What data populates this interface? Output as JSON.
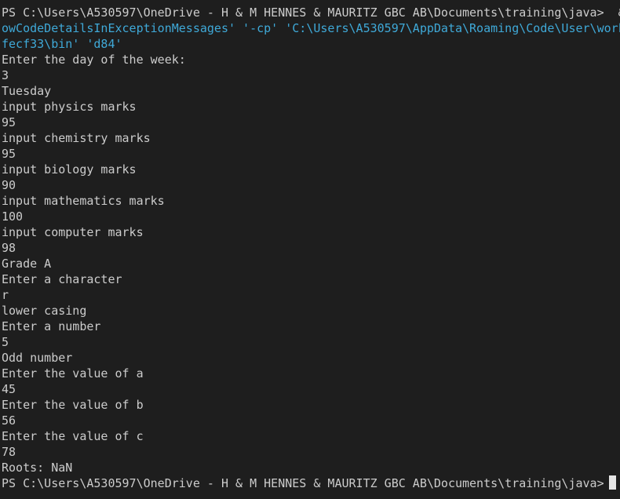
{
  "terminal": {
    "lines": [
      {
        "text": "PS C:\\Users\\A530597\\OneDrive - H & M HENNES & MAURITZ GBC AB\\Documents\\training\\java>  & ",
        "style": "prompt"
      },
      {
        "text": "owCodeDetailsInExceptionMessages' '-cp' 'C:\\Users\\A530597\\AppData\\Roaming\\Code\\User\\work",
        "style": "cyan"
      },
      {
        "text": "fecf33\\bin' 'd84'",
        "style": "cyan"
      },
      {
        "text": "Enter the day of the week:",
        "style": "output"
      },
      {
        "text": "3",
        "style": "output"
      },
      {
        "text": "Tuesday",
        "style": "output"
      },
      {
        "text": "input physics marks",
        "style": "output"
      },
      {
        "text": "95",
        "style": "output"
      },
      {
        "text": "input chemistry marks",
        "style": "output"
      },
      {
        "text": "95",
        "style": "output"
      },
      {
        "text": "input biology marks",
        "style": "output"
      },
      {
        "text": "90",
        "style": "output"
      },
      {
        "text": "input mathematics marks",
        "style": "output"
      },
      {
        "text": "100",
        "style": "output"
      },
      {
        "text": "input computer marks",
        "style": "output"
      },
      {
        "text": "98",
        "style": "output"
      },
      {
        "text": "Grade A",
        "style": "output"
      },
      {
        "text": "Enter a character",
        "style": "output"
      },
      {
        "text": "r",
        "style": "output"
      },
      {
        "text": "lower casing",
        "style": "output"
      },
      {
        "text": "Enter a number",
        "style": "output"
      },
      {
        "text": "5",
        "style": "output"
      },
      {
        "text": "Odd number",
        "style": "output"
      },
      {
        "text": "Enter the value of a",
        "style": "output"
      },
      {
        "text": "45",
        "style": "output"
      },
      {
        "text": "Enter the value of b",
        "style": "output"
      },
      {
        "text": "56",
        "style": "output"
      },
      {
        "text": "Enter the value of c",
        "style": "output"
      },
      {
        "text": "78",
        "style": "output"
      },
      {
        "text": "Roots: NaN",
        "style": "output"
      }
    ],
    "final_prompt": "PS C:\\Users\\A530597\\OneDrive - H & M HENNES & MAURITZ GBC AB\\Documents\\training\\java>"
  },
  "colors": {
    "background": "#1e1e1e",
    "foreground": "#cccccc",
    "path_arg": "#3fa9d8",
    "cursor": "#e6e6e6"
  }
}
